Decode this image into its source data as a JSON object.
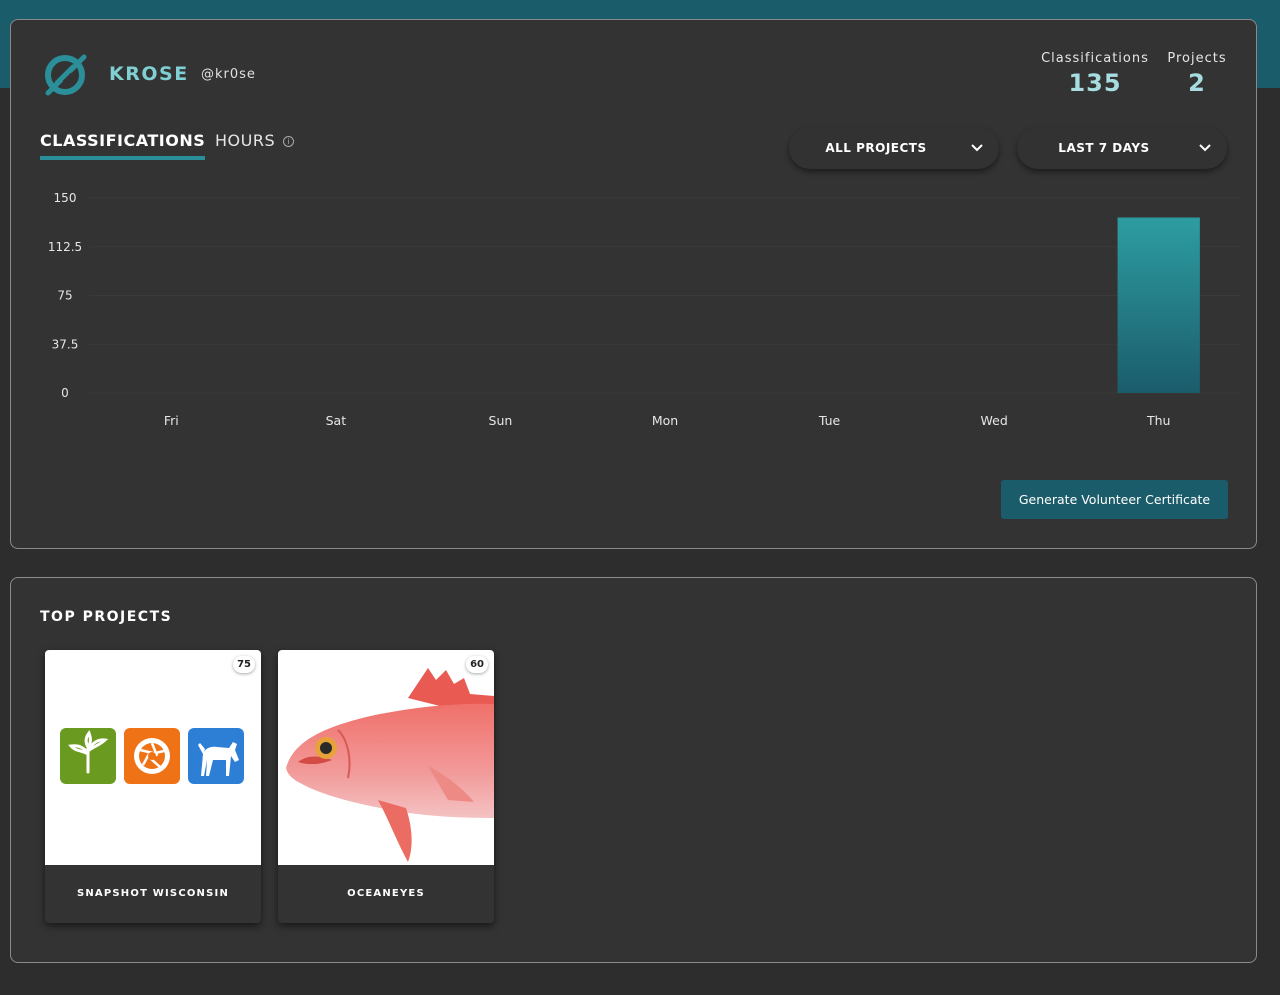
{
  "user": {
    "display_name": "KROSE",
    "login": "@kr0se"
  },
  "stats": {
    "classifications_label": "Classifications",
    "classifications_value": "135",
    "projects_label": "Projects",
    "projects_value": "2"
  },
  "tabs": {
    "classifications": "CLASSIFICATIONS",
    "hours": "HOURS"
  },
  "filters": {
    "project": "ALL PROJECTS",
    "range": "LAST 7 DAYS"
  },
  "colors": {
    "accent": "#2a8f99",
    "band": "#1b5c6b",
    "bar_top": "#2d9da2",
    "bar_bottom": "#1b5c6b"
  },
  "chart_data": {
    "type": "bar",
    "categories": [
      "Fri",
      "Sat",
      "Sun",
      "Mon",
      "Tue",
      "Wed",
      "Thu"
    ],
    "values": [
      0,
      0,
      0,
      0,
      0,
      0,
      135
    ],
    "yticks": [
      "0",
      "37.5",
      "75",
      "112.5",
      "150"
    ],
    "ylim": [
      0,
      150
    ],
    "grid": true
  },
  "certificate_button": "Generate Volunteer Certificate",
  "top_projects": {
    "title": "TOP PROJECTS",
    "items": [
      {
        "name": "SNAPSHOT WISCONSIN",
        "count": "75"
      },
      {
        "name": "OCEANEYES",
        "count": "60"
      }
    ]
  }
}
